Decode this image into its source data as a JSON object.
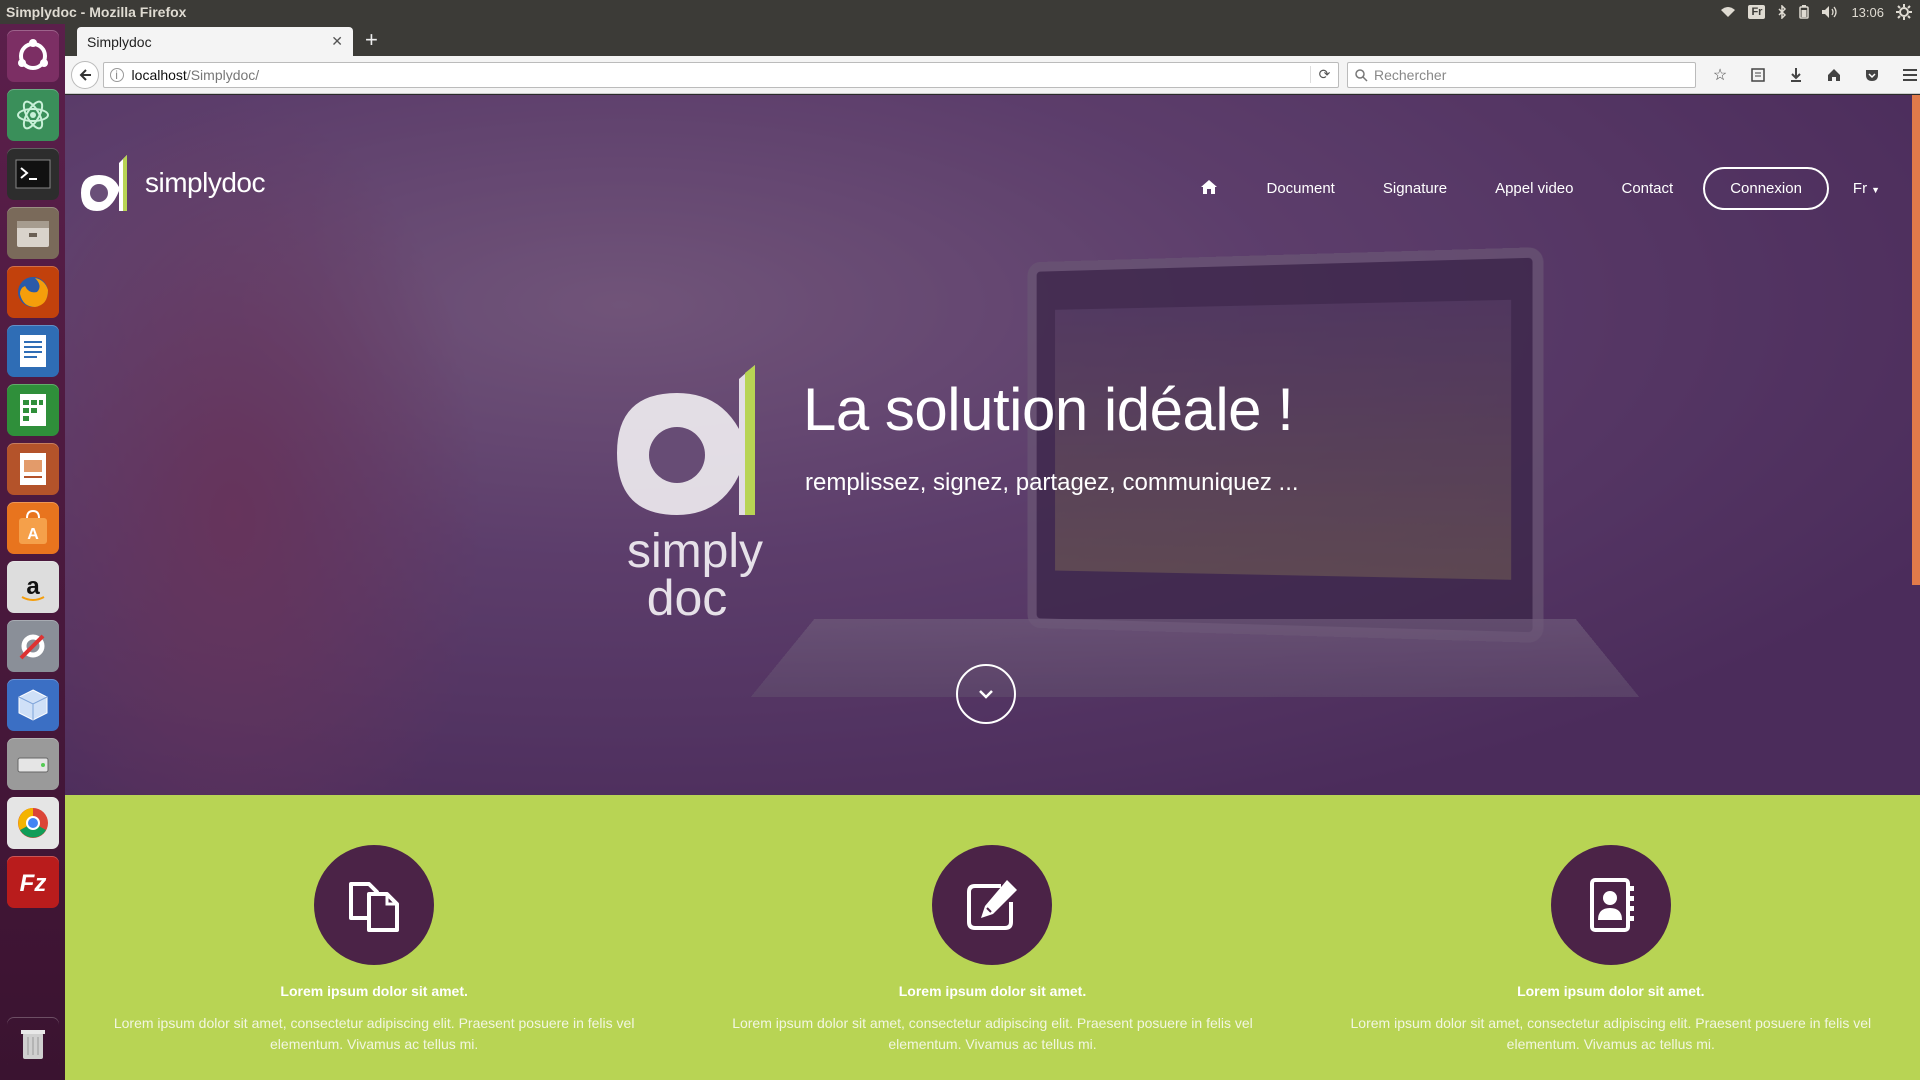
{
  "os": {
    "window_title": "Simplydoc - Mozilla Firefox",
    "keyboard_layout": "Fr",
    "clock": "13:06"
  },
  "launcher": {
    "apps": [
      "ubuntu-dash-icon",
      "atom-icon",
      "terminal-icon",
      "files-icon",
      "firefox-icon",
      "writer-icon",
      "calc-icon",
      "impress-icon",
      "software-center-icon",
      "amazon-icon",
      "system-settings-icon",
      "virtualbox-icon",
      "disk-icon",
      "chrome-icon",
      "filezilla-icon"
    ],
    "trash": "trash-icon"
  },
  "browser": {
    "tab_title": "Simplydoc",
    "url_host": "localhost",
    "url_path": "/Simplydoc/",
    "search_placeholder": "Rechercher"
  },
  "site": {
    "brand": "simplydoc",
    "nav": {
      "document": "Document",
      "signature": "Signature",
      "appel_video": "Appel video",
      "contact": "Contact",
      "connexion": "Connexion",
      "lang": "Fr"
    },
    "hero": {
      "title": "La solution idéale !",
      "subtitle": "remplissez, signez, partagez, communiquez ...",
      "logo_word_1": "simply",
      "logo_word_2": "doc"
    },
    "features": [
      {
        "title": "Lorem ipsum dolor sit amet.",
        "text": "Lorem ipsum dolor sit amet, consectetur adipiscing elit. Praesent posuere in felis vel elementum. Vivamus ac tellus mi.",
        "icon": "copy-files-icon"
      },
      {
        "title": "Lorem ipsum dolor sit amet.",
        "text": "Lorem ipsum dolor sit amet, consectetur adipiscing elit. Praesent posuere in felis vel elementum. Vivamus ac tellus mi.",
        "icon": "edit-pen-icon"
      },
      {
        "title": "Lorem ipsum dolor sit amet.",
        "text": "Lorem ipsum dolor sit amet, consectetur adipiscing elit. Praesent posuere in felis vel elementum. Vivamus ac tellus mi.",
        "icon": "address-book-icon"
      }
    ]
  },
  "colors": {
    "accent_green": "#b8d454",
    "brand_purple": "#4b2347",
    "launcher_purple": "#5b1f4b"
  }
}
